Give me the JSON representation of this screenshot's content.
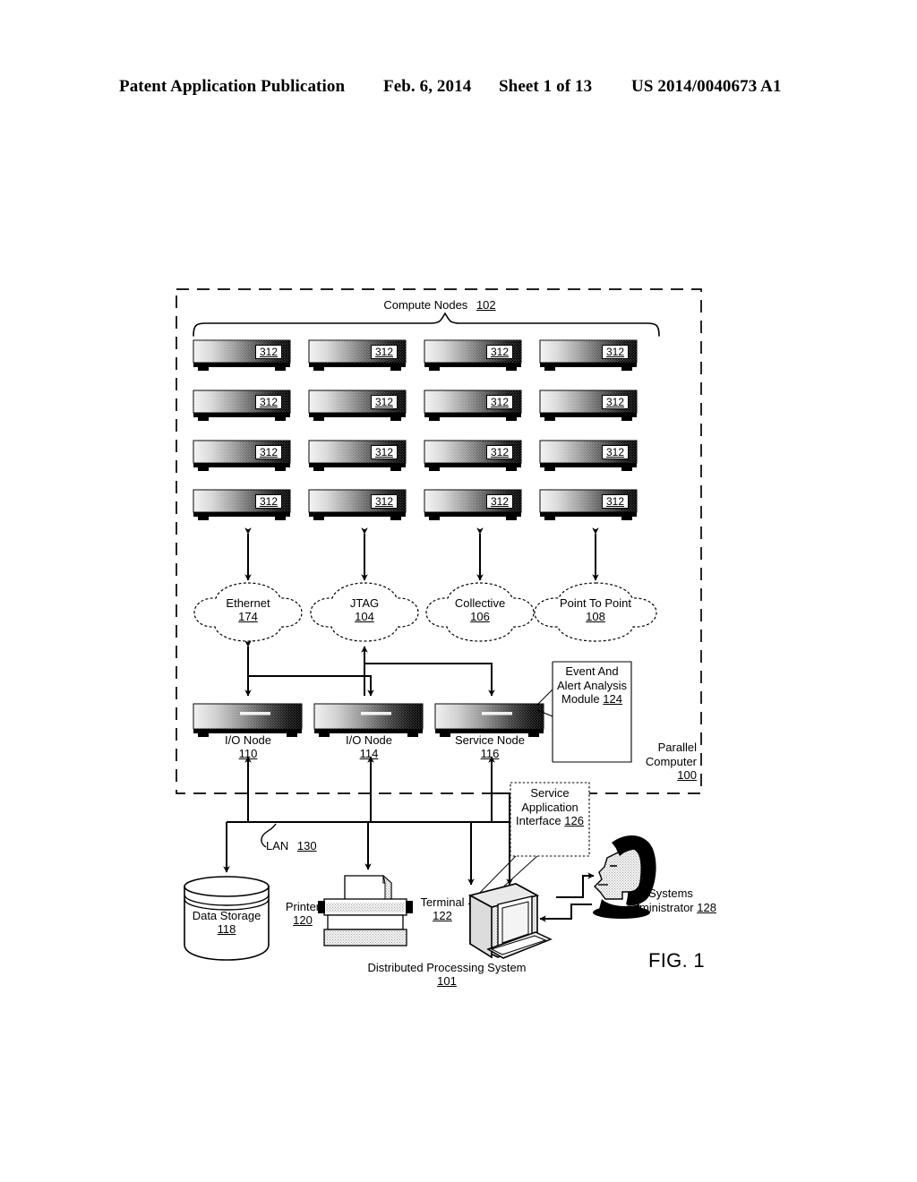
{
  "header": {
    "publication": "Patent Application Publication",
    "date": "Feb. 6, 2014",
    "sheet": "Sheet 1 of 13",
    "patent_number": "US 2014/0040673 A1"
  },
  "figure": {
    "caption": "FIG. 1",
    "compute_nodes": {
      "label": "Compute Nodes",
      "ref": "102",
      "node_ref": "312",
      "rows": 4,
      "cols": 4
    },
    "networks": [
      {
        "label": "Ethernet",
        "ref": "174"
      },
      {
        "label": "JTAG",
        "ref": "104"
      },
      {
        "label": "Collective",
        "ref": "106"
      },
      {
        "label": "Point To Point",
        "ref": "108"
      }
    ],
    "nodes": [
      {
        "label": "I/O Node",
        "ref": "110"
      },
      {
        "label": "I/O Node",
        "ref": "114"
      },
      {
        "label": "Service Node",
        "ref": "116"
      }
    ],
    "event_module": {
      "lines": [
        "Event And",
        "Alert",
        "Analysis",
        "Module"
      ],
      "ref": "124"
    },
    "service_interface": {
      "lines": [
        "Service",
        "Application",
        "Interface"
      ],
      "ref": "126"
    },
    "parallel_computer": {
      "lines": [
        "Parallel",
        "Computer"
      ],
      "ref": "100"
    },
    "lan": {
      "label": "LAN",
      "ref": "130"
    },
    "data_storage": {
      "label": "Data Storage",
      "ref": "118"
    },
    "printer": {
      "label": "Printer",
      "ref": "120"
    },
    "terminal": {
      "label": "Terminal",
      "ref": "122"
    },
    "administrator": {
      "lines": [
        "Systems",
        "Administrator"
      ],
      "ref": "128"
    },
    "distributed_system": {
      "label": "Distributed Processing System",
      "ref": "101"
    }
  },
  "colors": {
    "ink": "#000000",
    "paper": "#ffffff"
  }
}
